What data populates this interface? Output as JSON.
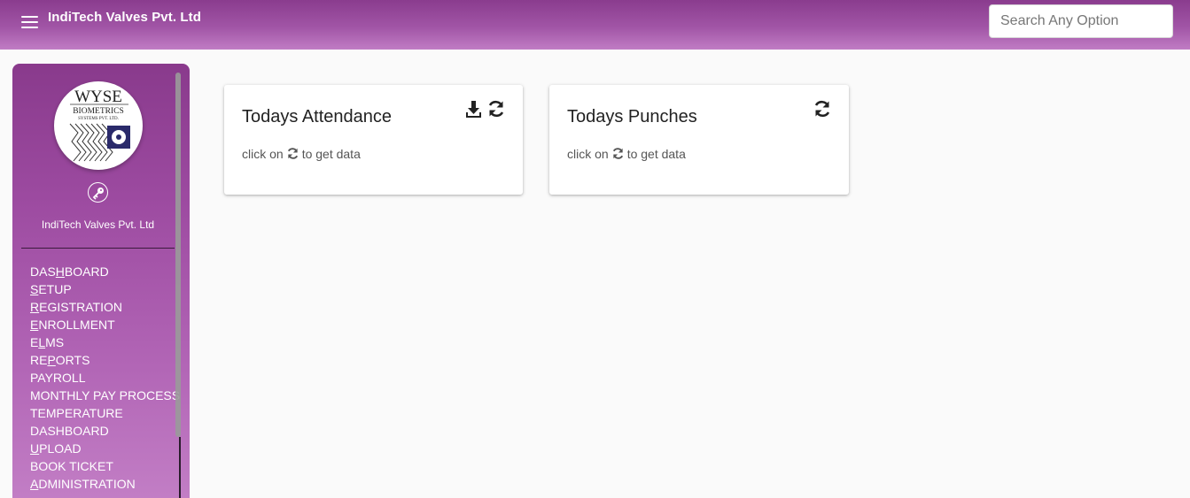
{
  "header": {
    "title": "IndiTech Valves Pvt. Ltd",
    "search_placeholder": "Search Any Option",
    "search_value": ""
  },
  "sidebar": {
    "logo": {
      "line1": "WYSE",
      "line2": "BIOMETRICS",
      "line3": "SYSTEMS PVT. LTD."
    },
    "company_name": "IndiTech Valves Pvt. Ltd",
    "menu": [
      {
        "pre": "DAS",
        "key": "H",
        "post": "BOARD"
      },
      {
        "pre": "",
        "key": "S",
        "post": "ETUP"
      },
      {
        "pre": "",
        "key": "R",
        "post": "EGISTRATION"
      },
      {
        "pre": "",
        "key": "E",
        "post": "NROLLMENT"
      },
      {
        "pre": "E",
        "key": "L",
        "post": "MS"
      },
      {
        "pre": "RE",
        "key": "P",
        "post": "ORTS"
      },
      {
        "pre": "PAYROLL",
        "key": "",
        "post": ""
      },
      {
        "pre": "MONTHLY PAY PROCESS",
        "key": "",
        "post": ""
      },
      {
        "pre": "TEMPERATURE",
        "key": "",
        "post": ""
      },
      {
        "pre": "DASHBOARD",
        "key": "",
        "post": ""
      },
      {
        "pre": "",
        "key": "U",
        "post": "PLOAD"
      },
      {
        "pre": "BOOK TICKET",
        "key": "",
        "post": ""
      },
      {
        "pre": "",
        "key": "A",
        "post": "DMINISTRATION"
      }
    ]
  },
  "cards": [
    {
      "title": "Todays Attendance",
      "sub_pre": "click on",
      "sub_post": "to get data"
    },
    {
      "title": "Todays Punches",
      "sub_pre": "click on",
      "sub_post": "to get data"
    }
  ],
  "icons": {
    "menu": "hamburger-icon",
    "key": "key-icon",
    "download": "download-icon",
    "refresh": "refresh-icon"
  },
  "colors": {
    "header_top": "#8a3c8e",
    "header_bottom": "#c07cc4",
    "sidebar_top": "#893a8c",
    "sidebar_bottom": "#c37fc6",
    "background": "#fafafa"
  }
}
